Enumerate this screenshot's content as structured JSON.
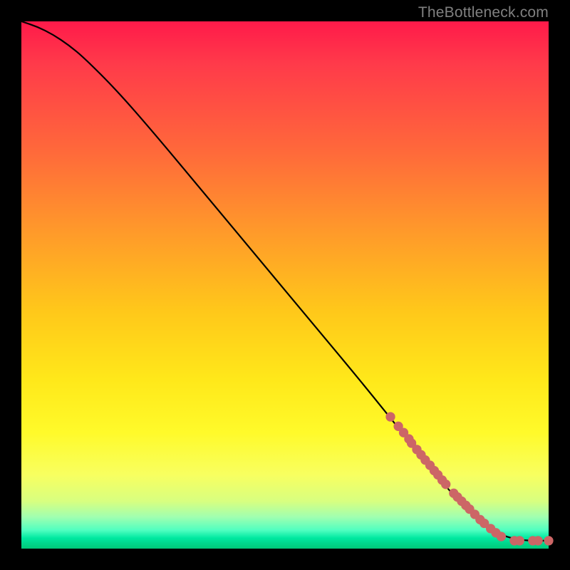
{
  "watermark": "TheBottleneck.com",
  "chart_data": {
    "type": "line",
    "title": "",
    "xlabel": "",
    "ylabel": "",
    "xlim": [
      0,
      100
    ],
    "ylim": [
      0,
      100
    ],
    "curve": {
      "name": "bottleneck-curve",
      "color": "#000000",
      "x": [
        0,
        3,
        6,
        9,
        12,
        18,
        25,
        35,
        45,
        55,
        65,
        73,
        78,
        82,
        85,
        88,
        91,
        95,
        100
      ],
      "y": [
        100,
        99,
        97.5,
        95.5,
        93,
        87,
        79,
        67,
        55,
        43,
        31,
        21,
        15,
        10,
        7,
        4.5,
        2.5,
        1.5,
        1.5
      ]
    },
    "points": {
      "name": "data-points",
      "color": "#cc6666",
      "radius_pct": 0.9,
      "x": [
        70,
        71.5,
        72.5,
        73.5,
        74,
        75,
        75.8,
        76.6,
        77.5,
        78.3,
        79,
        79.8,
        80.5,
        82,
        82.7,
        83.5,
        84.3,
        85,
        86,
        87,
        87.8,
        89,
        90,
        91,
        93.5,
        94.5,
        97,
        98,
        100
      ],
      "y": [
        25,
        23.2,
        22,
        20.8,
        20,
        18.8,
        17.8,
        16.8,
        15.8,
        14.8,
        14,
        13,
        12.2,
        10.5,
        9.8,
        9,
        8.2,
        7.5,
        6.5,
        5.5,
        4.8,
        3.8,
        3,
        2.3,
        1.5,
        1.5,
        1.5,
        1.5,
        1.5
      ]
    }
  }
}
